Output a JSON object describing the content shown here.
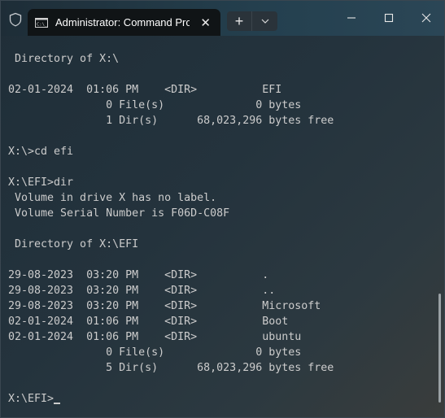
{
  "tab": {
    "title": "Administrator: Command Prompt",
    "title_visible": "Administrator: Command Pror",
    "icon": "cmd-icon",
    "close_label": "✕"
  },
  "titlebar": {
    "shield_icon": "shield-icon",
    "new_tab_label": "+",
    "dropdown_icon": "chevron-down-icon",
    "minimize_icon": "minimize-icon",
    "maximize_icon": "maximize-icon",
    "close_icon": "close-icon"
  },
  "terminal": {
    "lines": [
      " Directory of X:\\",
      "",
      "02-01-2024  01:06 PM    <DIR>          EFI",
      "               0 File(s)              0 bytes",
      "               1 Dir(s)      68,023,296 bytes free",
      "",
      "X:\\>cd efi",
      "",
      "X:\\EFI>dir",
      " Volume in drive X has no label.",
      " Volume Serial Number is F06D-C08F",
      "",
      " Directory of X:\\EFI",
      "",
      "29-08-2023  03:20 PM    <DIR>          .",
      "29-08-2023  03:20 PM    <DIR>          ..",
      "29-08-2023  03:20 PM    <DIR>          Microsoft",
      "02-01-2024  01:06 PM    <DIR>          Boot",
      "02-01-2024  01:06 PM    <DIR>          ubuntu",
      "               0 File(s)              0 bytes",
      "               5 Dir(s)      68,023,296 bytes free",
      "",
      "X:\\EFI>"
    ],
    "prompt": "X:\\EFI>"
  },
  "colors": {
    "text": "#cccccc",
    "tab_bg": "#101416",
    "background": "#1f2e38"
  }
}
